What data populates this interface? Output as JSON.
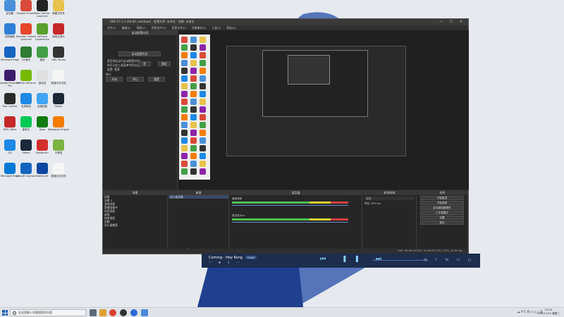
{
  "obs": {
    "title": "OBS 27.1.3 (64-bit, windows) - 配置文件: 未命名 - 场景: 未命名",
    "menu": [
      "文件(F)",
      "编辑(E)",
      "视图(V)",
      "停靠部件(D)",
      "配置文件(P)",
      "场景集合(S)",
      "工具(T)",
      "帮助(H)"
    ],
    "stats_panel": {
      "header": "自动配置向导",
      "button": "自动配置向导",
      "line1": "是否现在运行自动配置向导?",
      "line2": "你可以在工具菜单中再次运行",
      "line3": "配置: 宽屏",
      "yes": "是",
      "no": "否",
      "ok": "确定",
      "section": "统计",
      "start": "开始",
      "stop": "停止",
      "reset": "重置"
    },
    "scenes": {
      "header": "场景",
      "items": [
        "场景",
        "场景 2",
        "游戏场景",
        "直播准备中",
        "休息画面",
        "桌面",
        "结束画面",
        "闲聊",
        "显示器捕获"
      ]
    },
    "sources": {
      "header": "来源",
      "items": [
        "显示器采集"
      ]
    },
    "mixer": {
      "header": "混音器",
      "channels": [
        {
          "name": "桌面音频",
          "db": "0.0 dB"
        },
        {
          "name": "麦克风/Aux",
          "db": "0.0 dB"
        }
      ]
    },
    "transitions": {
      "header": "转场特效",
      "type": "淡出",
      "duration_label": "时长",
      "duration": "300 ms"
    },
    "controls": {
      "header": "控件",
      "buttons": [
        "开始推流",
        "开始录制",
        "启动虚拟摄像机",
        "工作室模式",
        "设置",
        "退出"
      ]
    },
    "status": "LIVE: 00:00:00   REC: 00:00:00   CPU: 1.6%, 30.00 fps"
  },
  "player": {
    "song": "Coming - Hey Kong",
    "badge": "24bit",
    "icons": "♡ ⊕ ⇩ ⋯",
    "transport": "⏮ ❚❚ ⏭",
    "right": "◷ ♪ ⇆ ▭ ◻"
  },
  "taskbar": {
    "search_placeholder": "在这里输入你要搜索的内容",
    "tray": "☁ 9°C 阴 ∧ ◫ ♪ 英",
    "time": "15:24",
    "date": "2022/11/15 星期二"
  },
  "desktop_icons": [
    {
      "label": "此电脑"
    },
    {
      "label": "Google Chrome"
    },
    {
      "label": "Epic Games Launcher"
    },
    {
      "label": "新建文件夹"
    },
    {
      "label": "控制面板"
    },
    {
      "label": "Rockstar Games Launcher"
    },
    {
      "label": "GeForce Experience"
    },
    {
      "label": "网易云音乐"
    },
    {
      "label": "Microsoft Edge"
    },
    {
      "label": "QQ音乐"
    },
    {
      "label": "微信"
    },
    {
      "label": "OBS Studio"
    },
    {
      "label": "Adobe Premiere Pro"
    },
    {
      "label": "NVIDIA GeForce"
    },
    {
      "label": "回收站"
    },
    {
      "label": "新建文本文档"
    },
    {
      "label": "Epic Games"
    },
    {
      "label": "应用商店"
    },
    {
      "label": "百度网盘"
    },
    {
      "label": "Steam"
    },
    {
      "label": "WPS Office"
    },
    {
      "label": "爱奇艺"
    },
    {
      "label": "Xbox"
    },
    {
      "label": "Wallpaper Engine"
    },
    {
      "label": "QQ"
    },
    {
      "label": "Steam"
    },
    {
      "label": "Bandicam"
    },
    {
      "label": "小黑盒"
    },
    {
      "label": "Microsoft Edge"
    },
    {
      "label": "Ubisoft Connect"
    },
    {
      "label": "Battle.net"
    },
    {
      "label": "新建文本文档"
    }
  ]
}
